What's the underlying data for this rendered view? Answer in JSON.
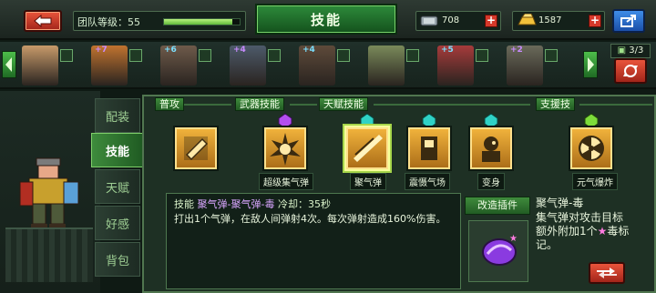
{
  "header": {
    "team_level_label": "团队等级：55",
    "team_progress": 0.9,
    "title": "技能",
    "resources": [
      {
        "icon": "gem-icon",
        "value": "708"
      },
      {
        "icon": "gold-bar-icon",
        "value": "1587"
      }
    ]
  },
  "heroes": {
    "count": "3/3",
    "items": [
      {
        "name": "hero-1",
        "plus": ""
      },
      {
        "name": "hero-2",
        "plus": "+7"
      },
      {
        "name": "hero-3",
        "plus": "+6"
      },
      {
        "name": "hero-4",
        "plus": "+4"
      },
      {
        "name": "hero-5",
        "plus": "+4"
      },
      {
        "name": "hero-6",
        "plus": ""
      },
      {
        "name": "hero-7",
        "plus": "+5"
      },
      {
        "name": "hero-8",
        "plus": "+2"
      }
    ]
  },
  "side_tabs": [
    {
      "label": "配装",
      "active": false
    },
    {
      "label": "技能",
      "active": true
    },
    {
      "label": "天赋",
      "active": false
    },
    {
      "label": "好感",
      "active": false
    },
    {
      "label": "背包",
      "active": false
    }
  ],
  "categories": {
    "normal": "普攻",
    "weapon": "武器技能",
    "talent": "天赋技能",
    "support": "支援技"
  },
  "skills": [
    {
      "name": "",
      "gem": ""
    },
    {
      "name": "超级集气弹",
      "gem": "purple"
    },
    {
      "name": "聚气弹",
      "gem": "cyan"
    },
    {
      "name": "震慑气场",
      "gem": "cyan"
    },
    {
      "name": "变身",
      "gem": "cyan"
    },
    {
      "name": "元气爆炸",
      "gem": "green"
    }
  ],
  "description": {
    "label": "技能",
    "name": "聚气弹-聚气弹-毒",
    "cooldown": "冷却：35秒",
    "body": "打出1个气弹，在敌人间弹射4次。每次弹射造成160%伤害。"
  },
  "plugin": {
    "header": "改造插件",
    "title": "聚气弹-毒",
    "text_before": "集气弹对攻击目标额外附加1个",
    "text_after": "毒标记。"
  },
  "colors": {
    "accent_green": "#3f8b3c",
    "panel_bg": "#1e3024",
    "gold": "#f3b53d",
    "purple_text": "#d9a6ff"
  }
}
